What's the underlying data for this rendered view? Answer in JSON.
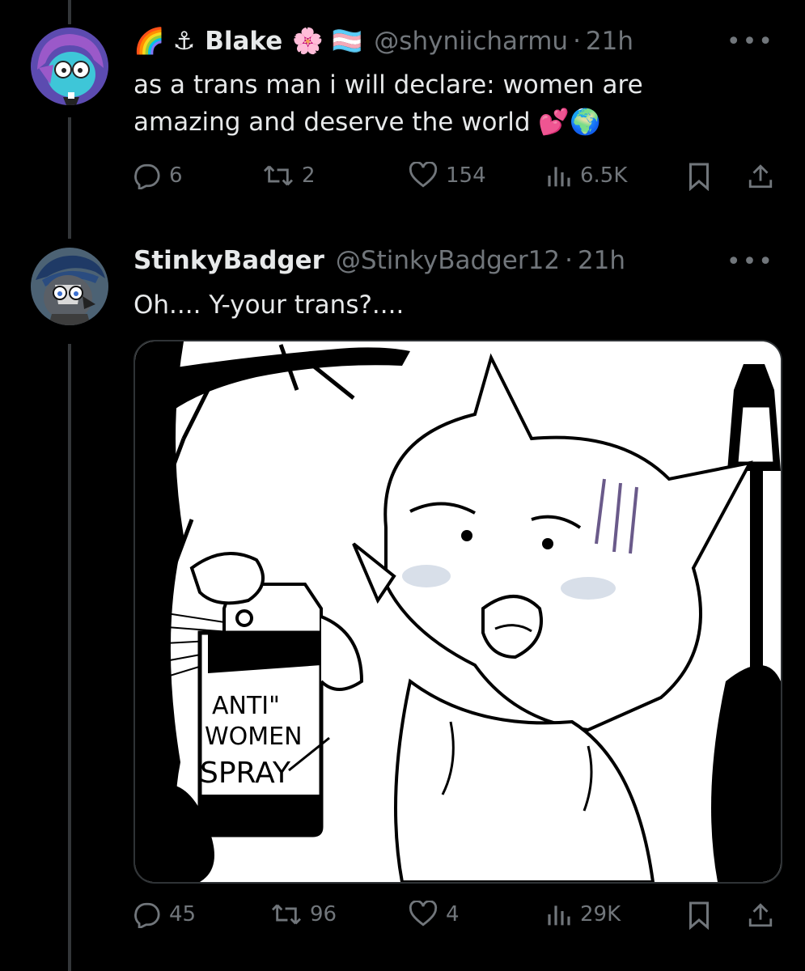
{
  "tweets": [
    {
      "prefix_emoji": "🌈 ⚓",
      "display_name": "Blake",
      "name_emoji": "🌸 🏳️‍⚧️",
      "handle": "@shyniicharmu",
      "dot": "·",
      "time": "21h",
      "more": "•••",
      "text_line1": "as a trans man i will declare: women are",
      "text_line2": "amazing and deserve the world 💕🌍",
      "replies": "6",
      "reposts": "2",
      "likes": "154",
      "views": "6.5K"
    },
    {
      "display_name": "StinkyBadger",
      "handle": "@StinkyBadger12",
      "dot": "·",
      "time": "21h",
      "more": "•••",
      "text_line1": "Oh.... Y-your trans?....",
      "media": {
        "spray_line1": "ANTI\"",
        "spray_line2": "WOMEN",
        "spray_line3": "SPRAY"
      },
      "replies": "45",
      "reposts": "96",
      "likes": "4",
      "views": "29K"
    }
  ],
  "colors": {
    "background": "#000000",
    "text": "#e7e9ea",
    "muted": "#71767b",
    "line": "#333639"
  }
}
